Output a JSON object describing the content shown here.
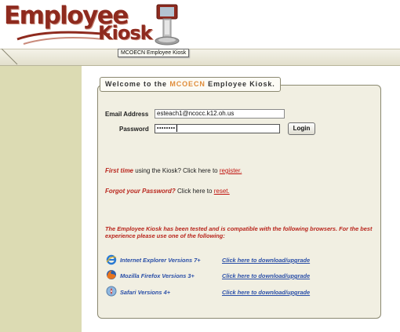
{
  "logo": {
    "line1": "Employee",
    "line2": "Kiosk"
  },
  "tooltip": "MCOECN Employee Kiosk",
  "icons": {
    "logo_swoosh": "swoosh-icon",
    "kiosk": "kiosk-terminal-icon"
  },
  "welcome": {
    "prefix": "Welcome to the ",
    "highlight": "MCOECN",
    "suffix": " Employee Kiosk."
  },
  "form": {
    "email_label": "Email Address",
    "email_value": "esteach1@ncocc.k12.oh.us",
    "password_label": "Password",
    "password_mask": "••••••••",
    "login_button": "Login"
  },
  "first_time": {
    "emph": "First time",
    "text": " using the Kiosk? Click here to ",
    "link": "register."
  },
  "forgot": {
    "emph": "Forgot your Password?",
    "text": " Click here to ",
    "link": "reset."
  },
  "notice": "The Employee Kiosk has been tested and is compatible with the following browsers. For the best experience please use one of the following:",
  "browsers": [
    {
      "icon": "internet-explorer-icon",
      "name": "Internet Explorer Versions 7+",
      "link": "Click here to download/upgrade"
    },
    {
      "icon": "firefox-icon",
      "name": "Mozilla Firefox Versions 3+",
      "link": "Click here to download/upgrade"
    },
    {
      "icon": "safari-icon",
      "name": "Safari Versions 4+",
      "link": "Click here to download/upgrade"
    }
  ],
  "colors": {
    "brand": "#8e2a1e",
    "sidebar": "#dcdbb3",
    "panel": "#f1efe2",
    "accent": "#e08d3a",
    "link_red": "#c0130f",
    "link_blue": "#2a4fa8"
  }
}
